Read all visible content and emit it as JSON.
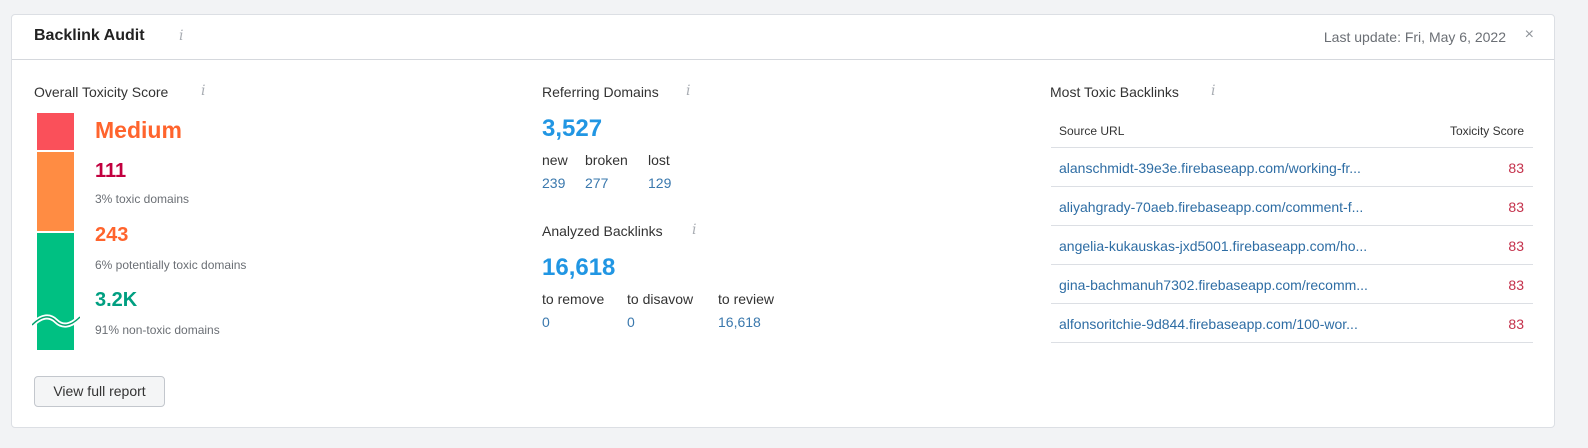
{
  "header": {
    "title": "Backlink Audit",
    "info": "i",
    "last_update": "Last update: Fri, May 6, 2022",
    "close": "×"
  },
  "toxicity": {
    "label": "Overall Toxicity Score",
    "info": "i",
    "level": "Medium",
    "toxic": {
      "count": "111",
      "desc": "3% toxic domains"
    },
    "potentially_toxic": {
      "count": "243",
      "desc": "6% potentially toxic domains"
    },
    "non_toxic": {
      "count": "3.2K",
      "desc": "91% non-toxic domains"
    },
    "button": "View full report",
    "colors": {
      "toxic": "#fa505a",
      "potentially_toxic": "#ff8c43",
      "non_toxic": "#00c082"
    }
  },
  "referring_domains": {
    "label": "Referring Domains",
    "info": "i",
    "total": "3,527",
    "metrics": [
      {
        "label": "new",
        "value": "239"
      },
      {
        "label": "broken",
        "value": "277"
      },
      {
        "label": "lost",
        "value": "129"
      }
    ]
  },
  "analyzed_backlinks": {
    "label": "Analyzed Backlinks",
    "info": "i",
    "total": "16,618",
    "metrics": [
      {
        "label": "to remove",
        "value": "0"
      },
      {
        "label": "to disavow",
        "value": "0"
      },
      {
        "label": "to review",
        "value": "16,618"
      }
    ]
  },
  "toxic_backlinks": {
    "label": "Most Toxic Backlinks",
    "info": "i",
    "columns": [
      "Source URL",
      "Toxicity Score"
    ],
    "rows": [
      {
        "url": "alanschmidt-39e3e.firebaseapp.com/working-fr...",
        "score": "83"
      },
      {
        "url": "aliyahgrady-70aeb.firebaseapp.com/comment-f...",
        "score": "83"
      },
      {
        "url": "angelia-kukauskas-jxd5001.firebaseapp.com/ho...",
        "score": "83"
      },
      {
        "url": "gina-bachmanuh7302.firebaseapp.com/recomm...",
        "score": "83"
      },
      {
        "url": "alfonsoritchie-9d844.firebaseapp.com/100-wor...",
        "score": "83"
      }
    ]
  }
}
